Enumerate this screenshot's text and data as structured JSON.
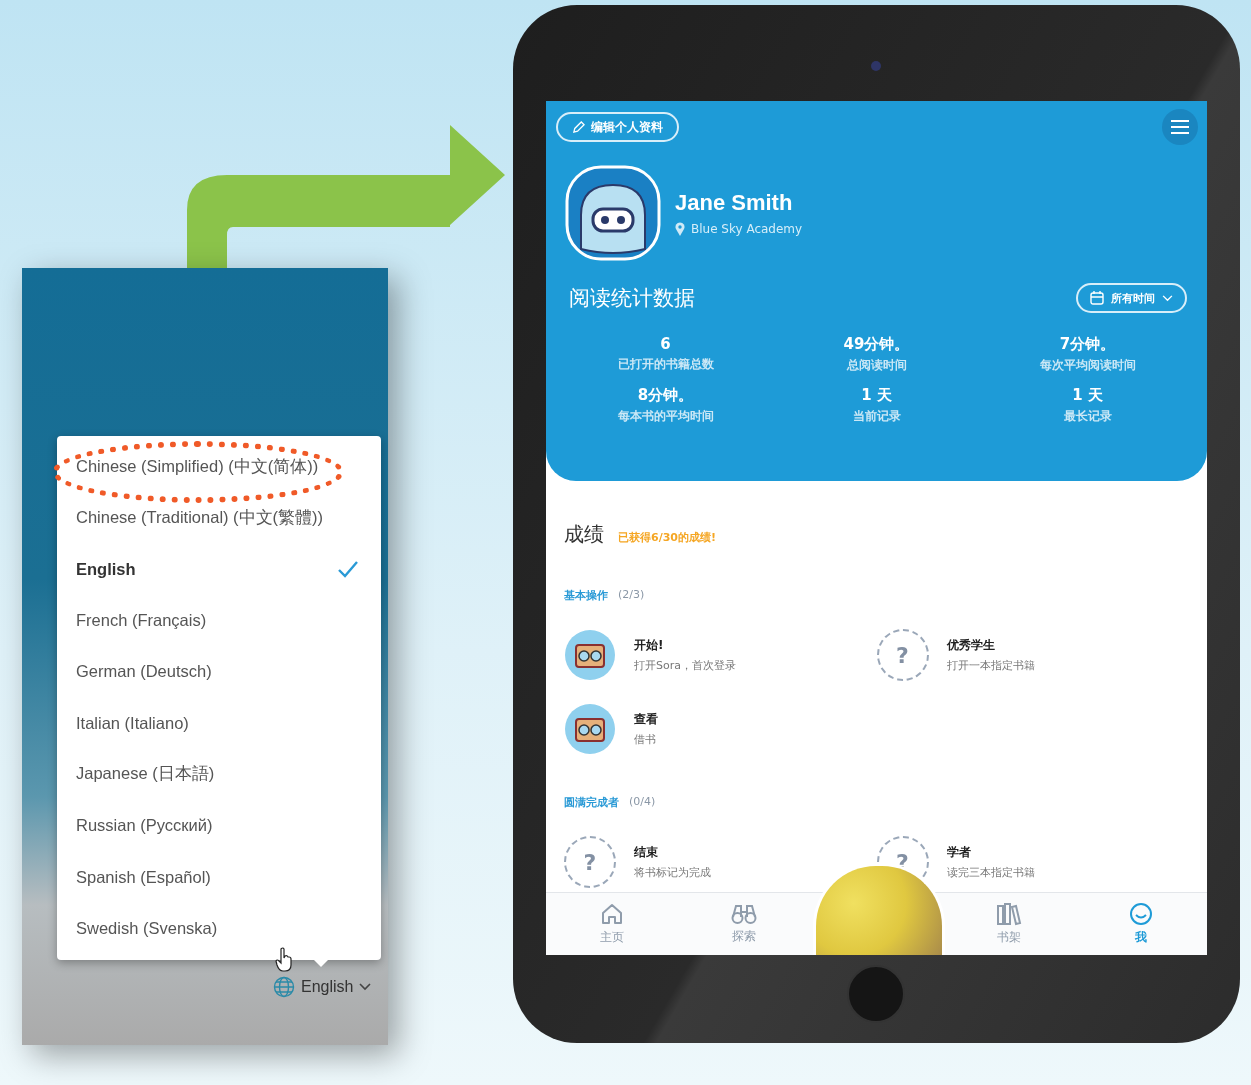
{
  "language_panel": {
    "options": [
      {
        "label": "Chinese (Simplified) (中文(简体))",
        "selected": false,
        "circled": true
      },
      {
        "label": "Chinese (Traditional) (中文(繁體))",
        "selected": false,
        "circled": false
      },
      {
        "label": "English",
        "selected": true,
        "circled": false
      },
      {
        "label": "French (Français)",
        "selected": false,
        "circled": false
      },
      {
        "label": "German (Deutsch)",
        "selected": false,
        "circled": false
      },
      {
        "label": "Italian (Italiano)",
        "selected": false,
        "circled": false
      },
      {
        "label": "Japanese (日本語)",
        "selected": false,
        "circled": false
      },
      {
        "label": "Russian (Русский)",
        "selected": false,
        "circled": false
      },
      {
        "label": "Spanish (Español)",
        "selected": false,
        "circled": false
      },
      {
        "label": "Swedish (Svenska)",
        "selected": false,
        "circled": false
      }
    ],
    "language_button": {
      "label": "English"
    }
  },
  "tablet_app": {
    "edit_profile_button": "编辑个人资料",
    "profile": {
      "name": "Jane Smith",
      "school": "Blue Sky Academy"
    },
    "stats": {
      "title": "阅读统计数据",
      "filter": "所有时间",
      "items": [
        {
          "value": "6",
          "label": "已打开的书籍总数"
        },
        {
          "value": "49分钟。",
          "label": "总阅读时间"
        },
        {
          "value": "7分钟。",
          "label": "每次平均阅读时间"
        },
        {
          "value": "8分钟。",
          "label": "每本书的平均时间"
        },
        {
          "value": "1 天",
          "label": "当前记录"
        },
        {
          "value": "1 天",
          "label": "最长记录"
        }
      ]
    },
    "achievements": {
      "title": "成绩",
      "summary": "已获得6/30的成绩!",
      "locked_symbol": "?",
      "groups": [
        {
          "name": "基本操作",
          "count": "(2/3)",
          "items": [
            {
              "title": "开始!",
              "description": "打开Sora，首次登录",
              "earned": true
            },
            {
              "title": "优秀学生",
              "description": "打开一本指定书籍",
              "earned": false
            },
            {
              "title": "查看",
              "description": "借书",
              "earned": true
            }
          ]
        },
        {
          "name": "圆满完成者",
          "count": "(0/4)",
          "items": [
            {
              "title": "结束",
              "description": "将书标记为完成",
              "earned": false
            },
            {
              "title": "学者",
              "description": "读完三本指定书籍",
              "earned": false
            }
          ]
        }
      ]
    },
    "nav": [
      {
        "label": "主页",
        "kind": "home",
        "selected": false
      },
      {
        "label": "探索",
        "kind": "explore",
        "selected": false
      },
      {
        "kind": "book"
      },
      {
        "label": "书架",
        "kind": "shelf",
        "selected": false
      },
      {
        "label": "我",
        "kind": "me",
        "selected": true
      }
    ]
  }
}
